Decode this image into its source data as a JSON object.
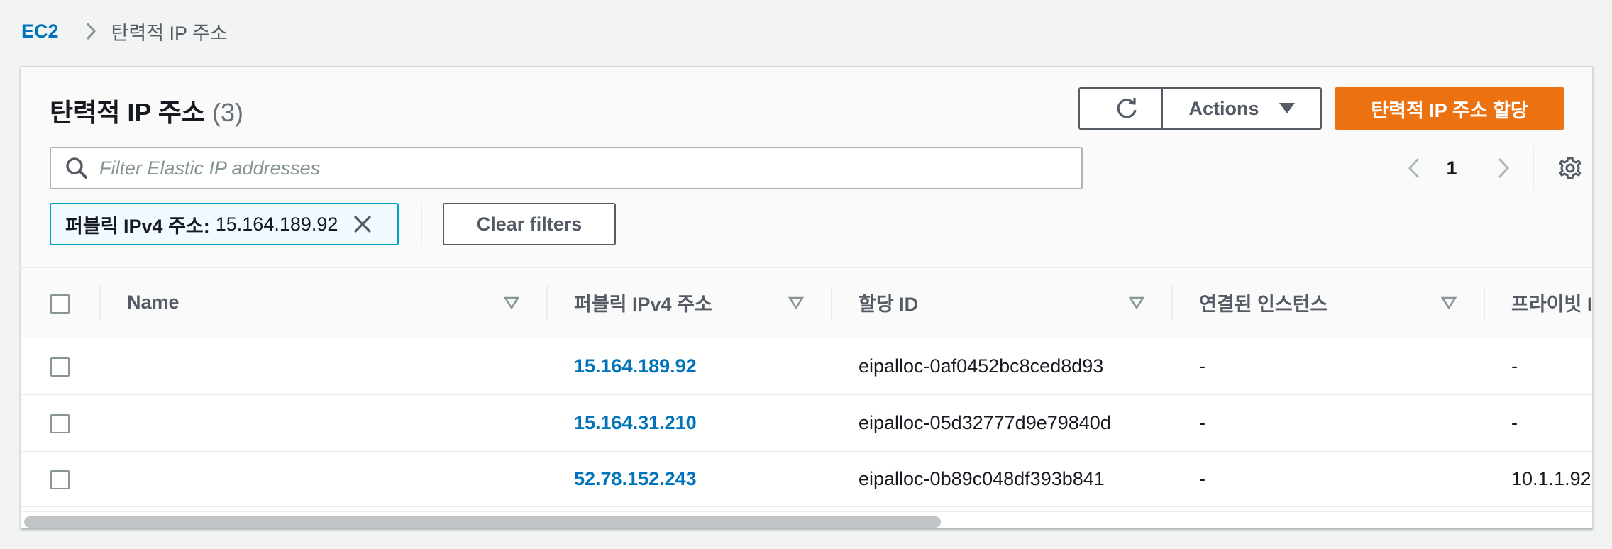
{
  "breadcrumb": {
    "root": "EC2",
    "current": "탄력적 IP 주소"
  },
  "header": {
    "title": "탄력적 IP 주소",
    "count": "(3)",
    "actions_label": "Actions",
    "allocate_label": "탄력적 IP 주소 할당",
    "accent_color": "#ec7211"
  },
  "search": {
    "placeholder": "Filter Elastic IP addresses",
    "value": ""
  },
  "pagination": {
    "current_page": "1"
  },
  "filter_token": {
    "key": "퍼블릭 IPv4 주소:",
    "value": "15.164.189.92"
  },
  "clear_filters_label": "Clear filters",
  "table": {
    "columns": [
      "Name",
      "퍼블릭 IPv4 주소",
      "할당 ID",
      "연결된 인스턴스",
      "프라이빗 IP"
    ],
    "rows": [
      {
        "name": "",
        "public_ip": "15.164.189.92",
        "allocation_id": "eipalloc-0af0452bc8ced8d93",
        "instance": "-",
        "private_ip": "-"
      },
      {
        "name": "",
        "public_ip": "15.164.31.210",
        "allocation_id": "eipalloc-05d32777d9e79840d",
        "instance": "-",
        "private_ip": "-"
      },
      {
        "name": "",
        "public_ip": "52.78.152.243",
        "allocation_id": "eipalloc-0b89c048df393b841",
        "instance": "-",
        "private_ip": "10.1.1.92"
      }
    ]
  },
  "icons": {
    "refresh": "refresh-icon",
    "caret": "caret-down-icon",
    "search": "search-icon",
    "prev": "chevron-left-icon",
    "next": "chevron-right-icon",
    "settings": "gear-icon",
    "close": "close-icon",
    "sort": "sort-icon"
  }
}
